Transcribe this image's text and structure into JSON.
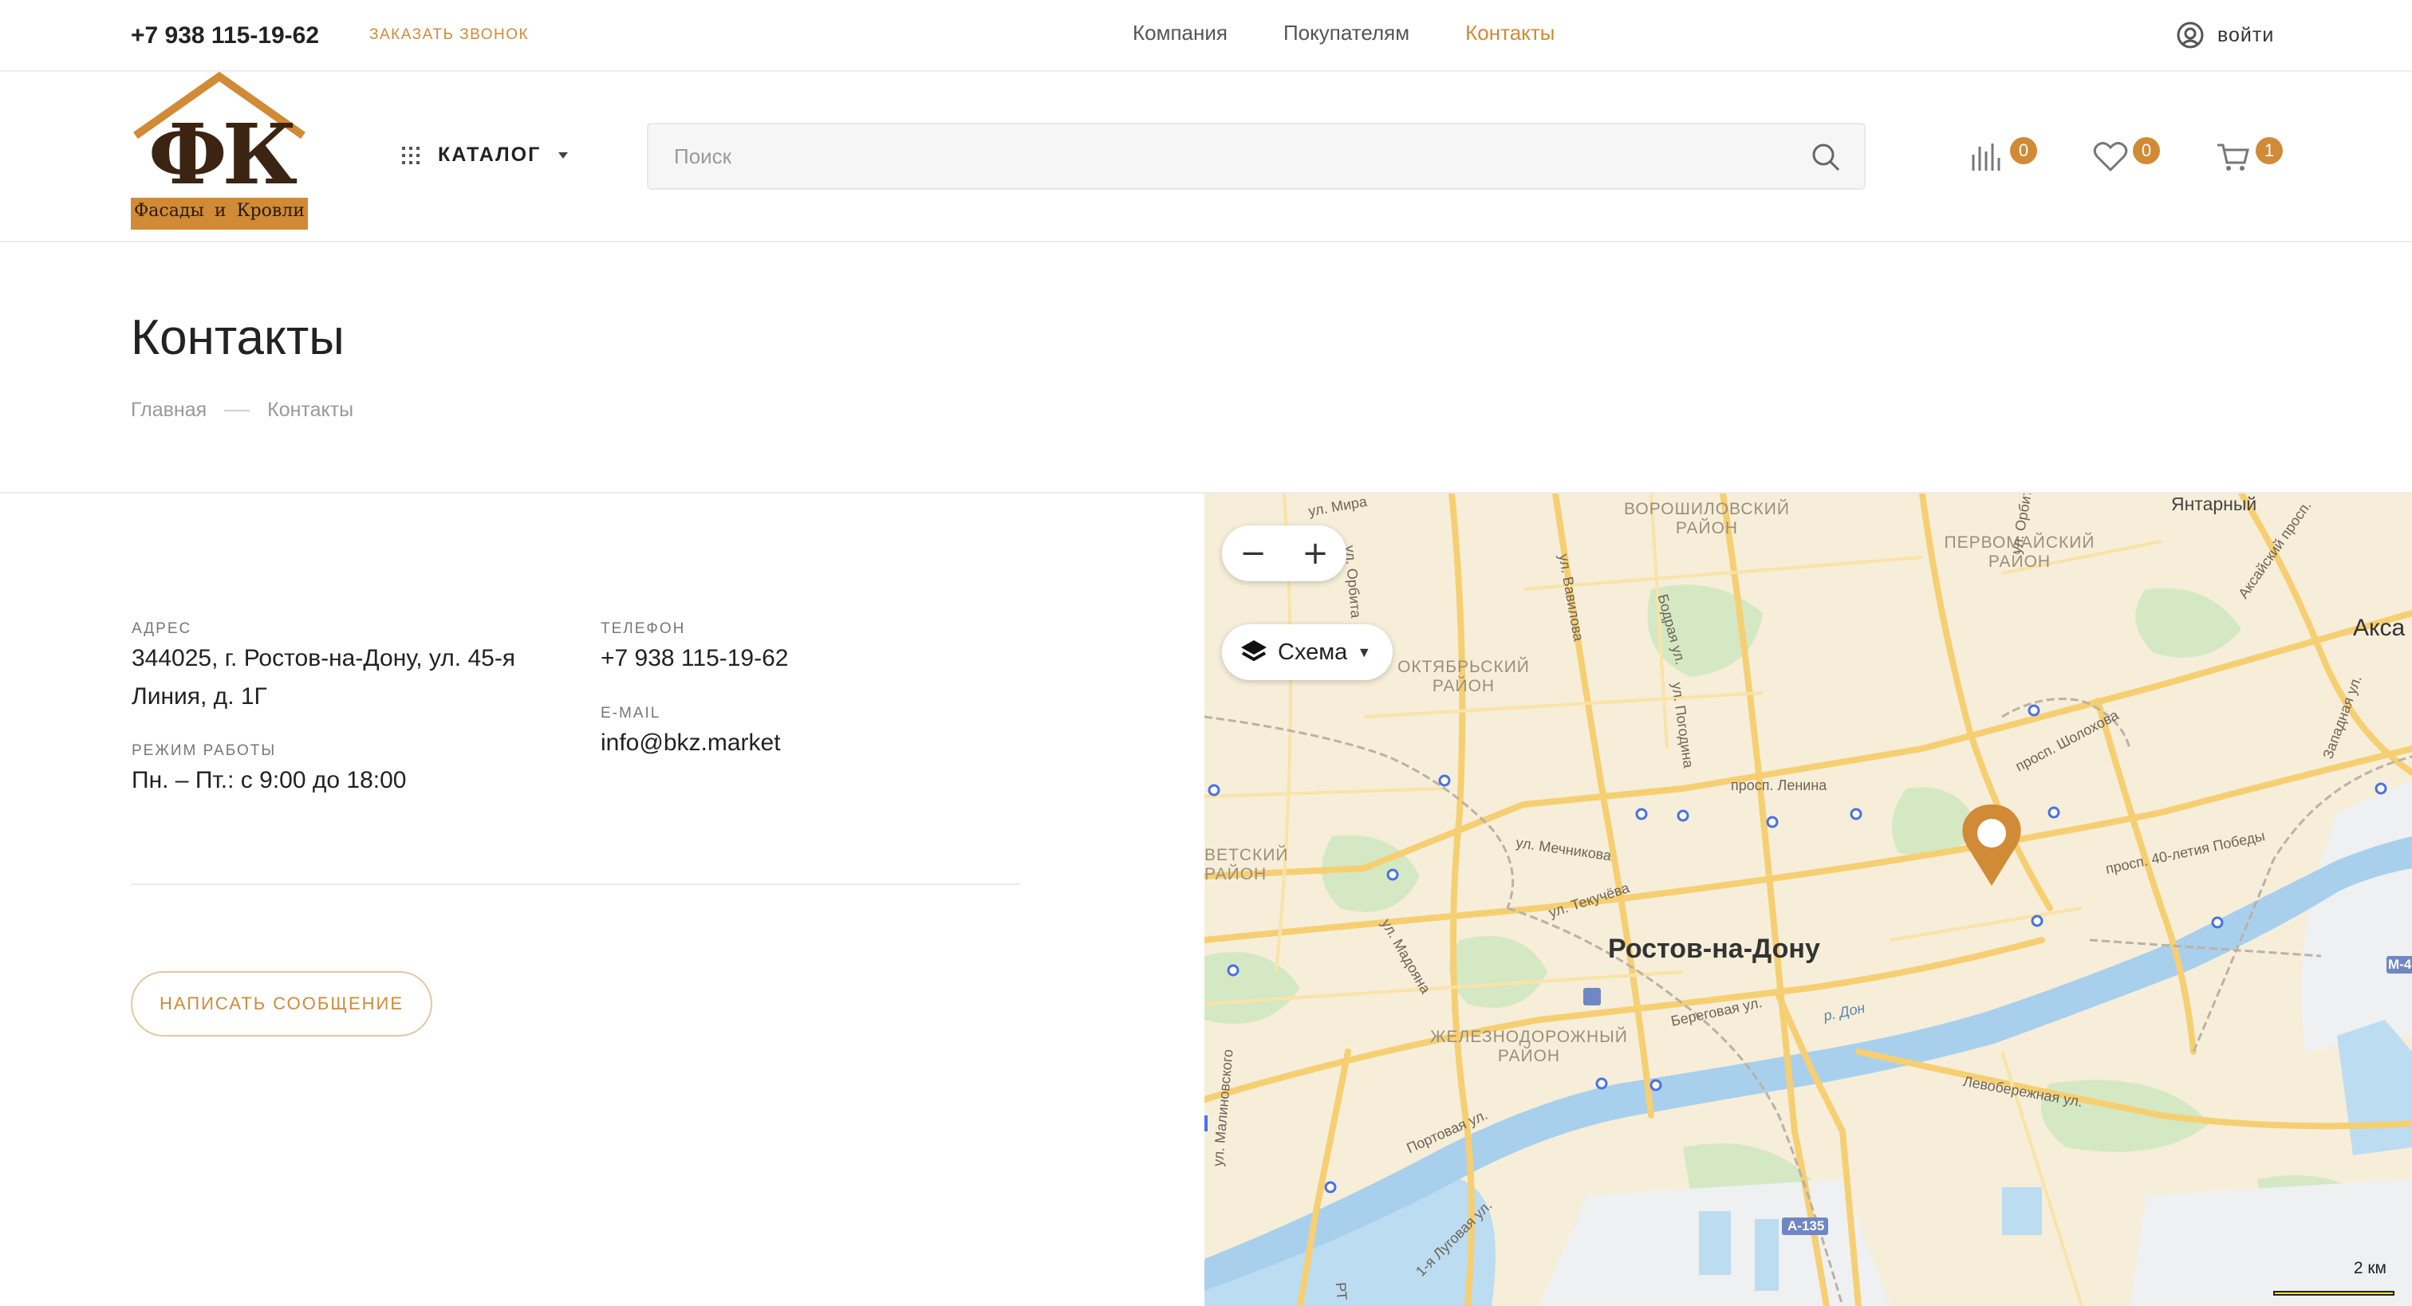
{
  "topbar": {
    "phone": "+7 938 115-19-62",
    "callback": "Заказать звонок",
    "nav": [
      {
        "label": "Компания",
        "active": false
      },
      {
        "label": "Покупателям",
        "active": false
      },
      {
        "label": "Контакты",
        "active": true
      }
    ],
    "login": "Войти"
  },
  "header": {
    "logo": {
      "letters": "ФК",
      "caption": "Фасады и Кровли"
    },
    "catalog": "Каталог",
    "search": {
      "placeholder": "Поиск",
      "value": ""
    },
    "compare_count": "0",
    "favorites_count": "0",
    "cart_count": "1"
  },
  "page": {
    "title": "Контакты",
    "breadcrumbs": [
      "Главная",
      "Контакты"
    ]
  },
  "contacts": {
    "address_label": "Адрес",
    "address_line1": "344025, г. Ростов-на-Дону, ул. 45-я",
    "address_line2": "Линия, д. 1Г",
    "hours_label": "Режим работы",
    "hours_value": "Пн. – Пт.: с 9:00 до 18:00",
    "phone_label": "Телефон",
    "phone_value": "+7 938 115-19-62",
    "email_label": "E-mail",
    "email_value": "info@bkz.market",
    "write_button": "Написать сообщение"
  },
  "map": {
    "city": "Ростов-на-Дону",
    "layer_label": "Схема",
    "zoom_out": "−",
    "zoom_in": "+",
    "scale": "2 км",
    "districts": {
      "voroshilovsky": [
        "Ворошиловский",
        "район"
      ],
      "pervomaisky": [
        "Первомайский",
        "район"
      ],
      "oktyabrsky": [
        "Октябрьский",
        "район"
      ],
      "sovetsky": [
        "ветский",
        "район"
      ],
      "zheleznodorozhny": [
        "Железнодорожный",
        "район"
      ],
      "yantarny": "Янтарный",
      "aksa": "Акса"
    },
    "streets": {
      "mira": "ул. Мира",
      "orbita": "ул. Орбита",
      "vavilova": "ул. Вавилова",
      "tabrya": "Бодрая ул.",
      "pogodina": "ул. Погодина",
      "lenina": "просп. Ленина",
      "sholokhova": "просп. Шолохова",
      "mechnikova": "ул. Мечникова",
      "tekucheva": "ул. Текучёва",
      "pobedy": "просп. 40-летия Победы",
      "madoyana": "ул. Мадояна",
      "malinovskogo": "ул. Малиновского",
      "beregovaya": "Береговая ул.",
      "don": "р. Дон",
      "levoberezhnaya": "Левобережная ул.",
      "portovaya": "Портовая ул.",
      "lugovaya": "1-я Луговая ул.",
      "aksaisky": "Аксайский просп.",
      "zapadnaya": "Западная ул.",
      "a135": "А-135",
      "m4": "М-4",
      "rt": "РТ"
    }
  }
}
